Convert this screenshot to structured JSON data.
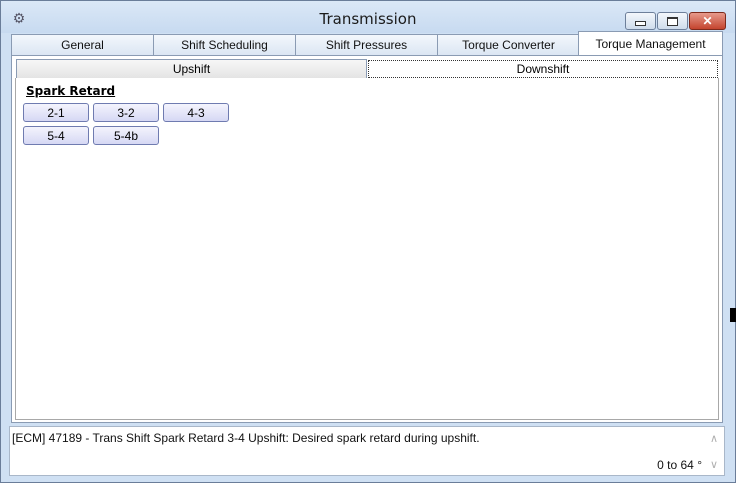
{
  "window": {
    "title": "Transmission",
    "icon": "gear-icon",
    "buttons": {
      "minimize": "minimize",
      "maximize": "maximize",
      "close": "✕"
    }
  },
  "tabs": [
    {
      "label": "General",
      "active": false
    },
    {
      "label": "Shift Scheduling",
      "active": false
    },
    {
      "label": "Shift Pressures",
      "active": false
    },
    {
      "label": "Torque Converter",
      "active": false
    },
    {
      "label": "Torque Management",
      "active": true
    }
  ],
  "subtabs": [
    {
      "label": "Upshift",
      "active": false
    },
    {
      "label": "Downshift",
      "active": true
    }
  ],
  "section": {
    "label": "Spark Retard"
  },
  "buttons": [
    "2-1",
    "3-2",
    "4-3",
    "5-4",
    "5-4b"
  ],
  "status": {
    "description": "[ECM] 47189 - Trans Shift Spark Retard 3-4 Upshift: Desired spark retard during upshift.",
    "range": "0 to 64 °"
  },
  "colors": {
    "titlebar": "#cfe0f3",
    "close_button": "#c4442e",
    "button_border": "#6f7bb0"
  }
}
